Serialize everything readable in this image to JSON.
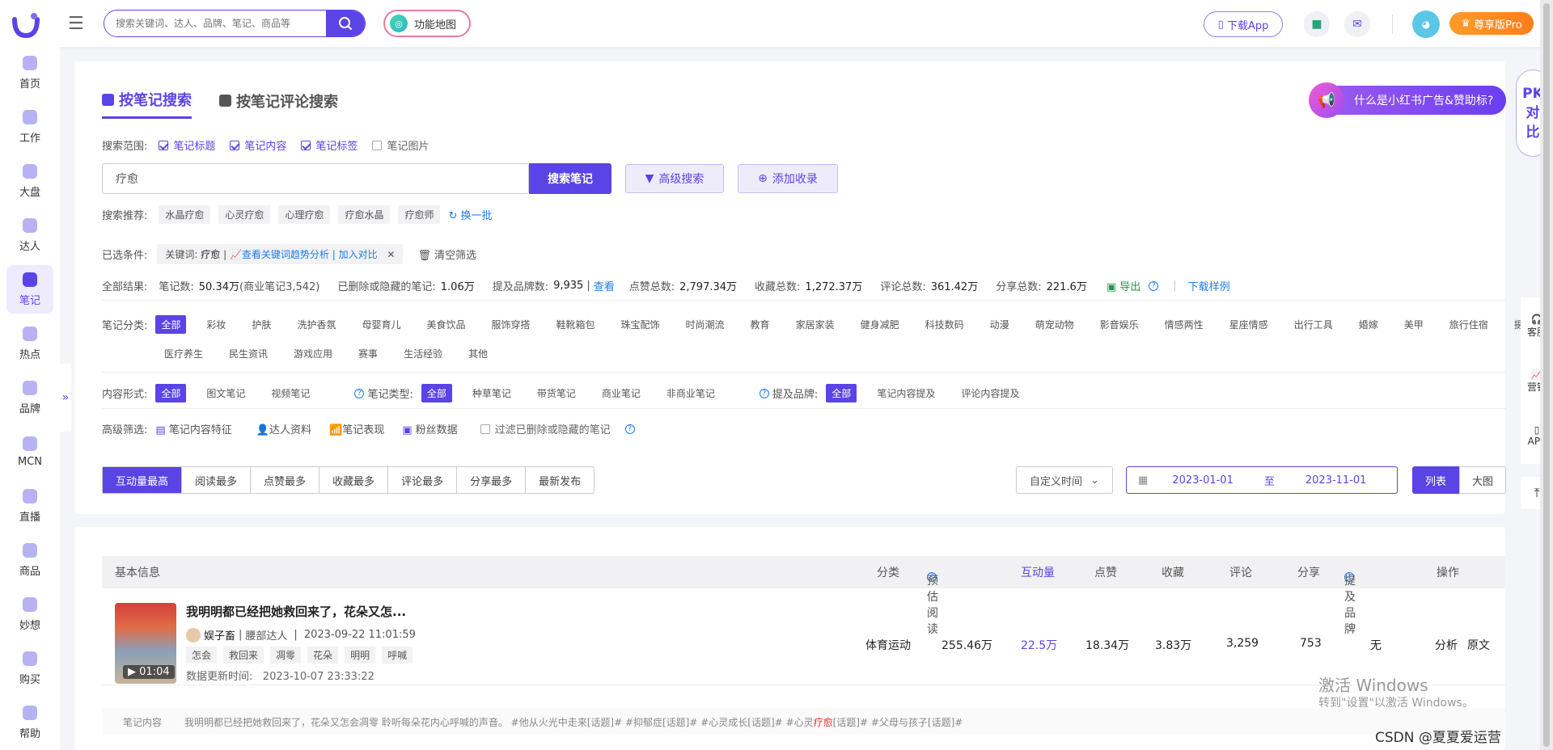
{
  "topbar": {
    "search_placeholder": "搜索关键词、达人、品牌、笔记、商品等",
    "funcmap": "功能地图",
    "download_app": "下载App",
    "pro": "尊享版Pro"
  },
  "sidebar": [
    {
      "label": "首页"
    },
    {
      "label": "工作"
    },
    {
      "label": "大盘"
    },
    {
      "label": "达人"
    },
    {
      "label": "笔记",
      "active": true
    },
    {
      "label": "热点"
    },
    {
      "label": "品牌"
    },
    {
      "label": "MCN"
    },
    {
      "label": "直播"
    },
    {
      "label": "商品"
    },
    {
      "label": "妙想"
    },
    {
      "label": "购买"
    },
    {
      "label": "帮助"
    }
  ],
  "tabs": [
    {
      "label": "按笔记搜索",
      "active": true
    },
    {
      "label": "按笔记评论搜索"
    }
  ],
  "ad_banner": "什么是小红书广告&赞助标?",
  "pk": [
    "PK",
    "对",
    "比"
  ],
  "scope": {
    "label": "搜索范围:",
    "options": [
      {
        "label": "笔记标题",
        "on": true
      },
      {
        "label": "笔记内容",
        "on": true
      },
      {
        "label": "笔记标签",
        "on": true
      },
      {
        "label": "笔记图片",
        "on": false
      }
    ]
  },
  "query": "疗愈",
  "search_btn": "搜索笔记",
  "advanced_btn": "高级搜索",
  "add_btn": "添加收录",
  "recommend": {
    "label": "搜索推荐:",
    "items": [
      "水晶疗愈",
      "心灵疗愈",
      "心理疗愈",
      "疗愈水晶",
      "疗愈师"
    ],
    "refresh": "换一批"
  },
  "selected": {
    "label": "已选条件:",
    "keyword_label": "关键词:",
    "keyword": "疗愈",
    "trend_link": "查看关键词趋势分析 | 加入对比",
    "clear": "清空筛选"
  },
  "results": {
    "label": "全部结果:",
    "notes_label": "笔记数:",
    "notes": "50.34万",
    "commercial": "(商业笔记3,542)",
    "deleted_label": "已删除或隐藏的笔记:",
    "deleted": "1.06万",
    "brands_label": "提及品牌数:",
    "brands": "9,935",
    "view": "查看",
    "likes_label": "点赞总数:",
    "likes": "2,797.34万",
    "collects_label": "收藏总数:",
    "collects": "1,272.37万",
    "comments_label": "评论总数:",
    "comments": "361.42万",
    "shares_label": "分享总数:",
    "shares": "221.6万",
    "export": "导出",
    "sample": "下载样例"
  },
  "category": {
    "label": "笔记分类:",
    "row1": [
      "全部",
      "彩妆",
      "护肤",
      "洗护香氛",
      "母婴育儿",
      "美食饮品",
      "服饰穿搭",
      "鞋靴箱包",
      "珠宝配饰",
      "时尚潮流",
      "教育",
      "家居家装",
      "健身减肥",
      "科技数码",
      "动漫",
      "萌宠动物",
      "影音娱乐",
      "情感两性",
      "星座情感",
      "出行工具",
      "婚嫁",
      "美甲",
      "旅行住宿",
      "摄影"
    ],
    "row2": [
      "医疗养生",
      "民生资讯",
      "游戏应用",
      "赛事",
      "生活经验",
      "其他"
    ]
  },
  "form": {
    "label": "内容形式:",
    "items": [
      "全部",
      "图文笔记",
      "视频笔记"
    ]
  },
  "ntype": {
    "label": "笔记类型:",
    "items": [
      "全部",
      "种草笔记",
      "带货笔记",
      "商业笔记",
      "非商业笔记"
    ]
  },
  "brand": {
    "label": "提及品牌:",
    "items": [
      "全部",
      "笔记内容提及",
      "评论内容提及"
    ]
  },
  "adv": {
    "label": "高级筛选:",
    "items": [
      "笔记内容特征",
      "达人资料",
      "笔记表现",
      "粉丝数据"
    ],
    "filter": "过滤已删除或隐藏的笔记"
  },
  "sort": [
    "互动量最高",
    "阅读最多",
    "点赞最多",
    "收藏最多",
    "评论最多",
    "分享最多",
    "最新发布"
  ],
  "time_select": "自定义时间",
  "date_start": "2023-01-01",
  "date_sep": "至",
  "date_end": "2023-11-01",
  "view_list": "列表",
  "view_big": "大图",
  "table": {
    "headers": {
      "basic": "基本信息",
      "cat": "分类",
      "read": "预估阅读",
      "inter": "互动量",
      "like": "点赞",
      "collect": "收藏",
      "comment": "评论",
      "share": "分享",
      "brand": "提及品牌",
      "op": "操作"
    }
  },
  "note": {
    "title": "我明明都已经把她救回来了，花朵又怎...",
    "duration": "01:04",
    "author": "娱子畜",
    "level": "腰部达人",
    "time": "2023-09-22 11:01:59",
    "tags": [
      "怎会",
      "救回来",
      "凋零",
      "花朵",
      "明明",
      "呼喊"
    ],
    "update_label": "数据更新时间:",
    "update": "2023-10-07 23:33:22",
    "cat": "体育运动",
    "read": "255.46万",
    "inter": "22.5万",
    "like": "18.34万",
    "collect": "3.83万",
    "comment": "3,259",
    "share": "753",
    "brand": "无",
    "analyze": "分析",
    "origin": "原文",
    "content_label": "笔记内容",
    "content_a": "我明明都已经把她救回来了，花朵又怎会凋零 聆听每朵花内心呼喊的声音。 #他从火光中走来[话题]# #抑郁症[话题]# #心灵成长[话题]# #心灵",
    "content_hl": "疗愈",
    "content_b": "[话题]# #父母与孩子[话题]#"
  },
  "right_tools": [
    "客服",
    "营销",
    "APP"
  ],
  "watermark": {
    "line1": "激活 Windows",
    "line2": "转到\"设置\"以激活 Windows。"
  },
  "csdn": "CSDN @夏夏爱运营"
}
